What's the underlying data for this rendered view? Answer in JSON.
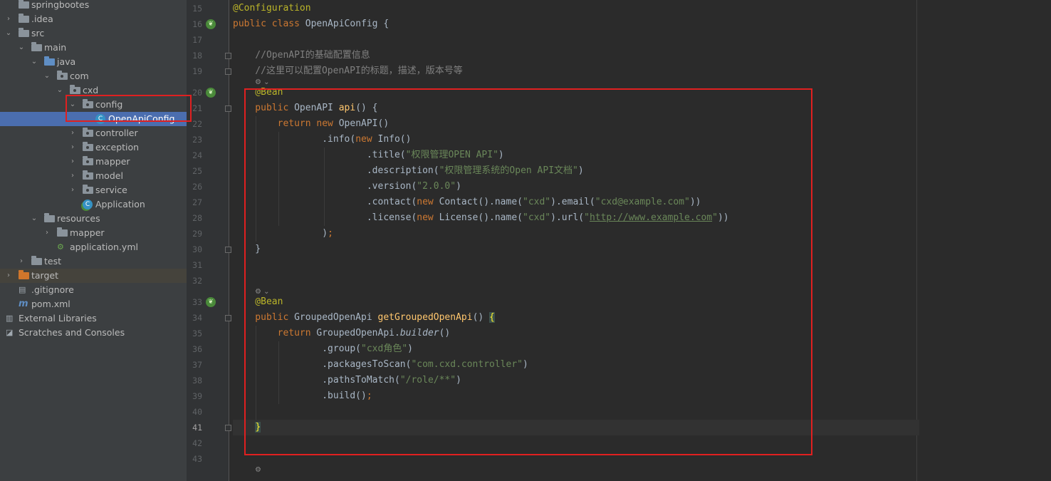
{
  "tree": {
    "items": [
      {
        "label": "springbootes",
        "depth": 0,
        "arrow": "",
        "icon": "folder"
      },
      {
        "label": ".idea",
        "depth": 0,
        "arrow": "›",
        "icon": "folder"
      },
      {
        "label": "src",
        "depth": 0,
        "arrow": "⌄",
        "icon": "folder"
      },
      {
        "label": "main",
        "depth": 1,
        "arrow": "⌄",
        "icon": "folder"
      },
      {
        "label": "java",
        "depth": 2,
        "arrow": "⌄",
        "icon": "folder-blue"
      },
      {
        "label": "com",
        "depth": 3,
        "arrow": "⌄",
        "icon": "package"
      },
      {
        "label": "cxd",
        "depth": 4,
        "arrow": "⌄",
        "icon": "package"
      },
      {
        "label": "config",
        "depth": 5,
        "arrow": "⌄",
        "icon": "package"
      },
      {
        "label": "OpenApiConfig",
        "depth": 6,
        "arrow": "",
        "icon": "class",
        "selected": true
      },
      {
        "label": "controller",
        "depth": 5,
        "arrow": "›",
        "icon": "package"
      },
      {
        "label": "exception",
        "depth": 5,
        "arrow": "›",
        "icon": "package"
      },
      {
        "label": "mapper",
        "depth": 5,
        "arrow": "›",
        "icon": "package"
      },
      {
        "label": "model",
        "depth": 5,
        "arrow": "›",
        "icon": "package"
      },
      {
        "label": "service",
        "depth": 5,
        "arrow": "›",
        "icon": "package"
      },
      {
        "label": "Application",
        "depth": 5,
        "arrow": "",
        "icon": "spring-class"
      },
      {
        "label": "resources",
        "depth": 2,
        "arrow": "⌄",
        "icon": "resources"
      },
      {
        "label": "mapper",
        "depth": 3,
        "arrow": "›",
        "icon": "folder"
      },
      {
        "label": "application.yml",
        "depth": 3,
        "arrow": "",
        "icon": "yml"
      },
      {
        "label": "test",
        "depth": 1,
        "arrow": "›",
        "icon": "folder"
      },
      {
        "label": "target",
        "depth": 0,
        "arrow": "›",
        "icon": "folder-orange"
      },
      {
        "label": ".gitignore",
        "depth": 0,
        "arrow": "",
        "icon": "file"
      },
      {
        "label": "pom.xml",
        "depth": 0,
        "arrow": "",
        "icon": "maven"
      },
      {
        "label": "External Libraries",
        "depth": -1,
        "arrow": "",
        "icon": "libraries"
      },
      {
        "label": "Scratches and Consoles",
        "depth": -1,
        "arrow": "",
        "icon": "scratches"
      }
    ]
  },
  "editor": {
    "current_line": "41",
    "lines": [
      {
        "n": "15",
        "code": [
          {
            "t": "@Configuration",
            "c": "an"
          }
        ]
      },
      {
        "n": "16",
        "code": [
          {
            "t": "public class ",
            "c": "kw"
          },
          {
            "t": "OpenApiConfig {",
            "c": ""
          }
        ]
      },
      {
        "n": "17",
        "code": []
      },
      {
        "n": "18",
        "code": [
          {
            "t": "    //OpenAPI的基础配置信息",
            "c": "cm"
          }
        ]
      },
      {
        "n": "19",
        "code": [
          {
            "t": "    //这里可以配置OpenAPI的标题，描述，版本号等",
            "c": "cm"
          }
        ]
      },
      {
        "n": "20",
        "code": [
          {
            "t": "    @Bean",
            "c": "an"
          }
        ]
      },
      {
        "n": "21",
        "code": [
          {
            "t": "    public ",
            "c": "kw"
          },
          {
            "t": "OpenAPI ",
            "c": ""
          },
          {
            "t": "api",
            "c": "fn"
          },
          {
            "t": "() {",
            "c": ""
          }
        ]
      },
      {
        "n": "22",
        "code": [
          {
            "t": "        return new ",
            "c": "kw"
          },
          {
            "t": "OpenAPI()",
            "c": ""
          }
        ]
      },
      {
        "n": "23",
        "code": [
          {
            "t": "                .info(",
            "c": ""
          },
          {
            "t": "new ",
            "c": "kw"
          },
          {
            "t": "Info()",
            "c": ""
          }
        ]
      },
      {
        "n": "24",
        "code": [
          {
            "t": "                        .title(",
            "c": ""
          },
          {
            "t": "\"权限管理OPEN API\"",
            "c": "st"
          },
          {
            "t": ")",
            "c": ""
          }
        ]
      },
      {
        "n": "25",
        "code": [
          {
            "t": "                        .description(",
            "c": ""
          },
          {
            "t": "\"权限管理系统的Open API文档\"",
            "c": "st"
          },
          {
            "t": ")",
            "c": ""
          }
        ]
      },
      {
        "n": "26",
        "code": [
          {
            "t": "                        .version(",
            "c": ""
          },
          {
            "t": "\"2.0.0\"",
            "c": "st"
          },
          {
            "t": ")",
            "c": ""
          }
        ]
      },
      {
        "n": "27",
        "code": [
          {
            "t": "                        .contact(",
            "c": ""
          },
          {
            "t": "new ",
            "c": "kw"
          },
          {
            "t": "Contact().name(",
            "c": ""
          },
          {
            "t": "\"cxd\"",
            "c": "st"
          },
          {
            "t": ").email(",
            "c": ""
          },
          {
            "t": "\"cxd@example.com\"",
            "c": "st"
          },
          {
            "t": "))",
            "c": ""
          }
        ]
      },
      {
        "n": "28",
        "code": [
          {
            "t": "                        .license(",
            "c": ""
          },
          {
            "t": "new ",
            "c": "kw"
          },
          {
            "t": "License().name(",
            "c": ""
          },
          {
            "t": "\"cxd\"",
            "c": "st"
          },
          {
            "t": ").url(",
            "c": ""
          },
          {
            "t": "\"",
            "c": "st"
          },
          {
            "t": "http://www.example.com",
            "c": "lnk"
          },
          {
            "t": "\"",
            "c": "st"
          },
          {
            "t": "))",
            "c": ""
          }
        ]
      },
      {
        "n": "29",
        "code": [
          {
            "t": "                )",
            "c": ""
          },
          {
            "t": ";",
            "c": "kw"
          }
        ]
      },
      {
        "n": "30",
        "code": [
          {
            "t": "    }",
            "c": ""
          }
        ]
      },
      {
        "n": "31",
        "code": []
      },
      {
        "n": "32",
        "code": []
      },
      {
        "n": "33",
        "code": [
          {
            "t": "    @Bean",
            "c": "an"
          }
        ]
      },
      {
        "n": "34",
        "code": [
          {
            "t": "    public ",
            "c": "kw"
          },
          {
            "t": "GroupedOpenApi ",
            "c": ""
          },
          {
            "t": "getGroupedOpenApi",
            "c": "fn"
          },
          {
            "t": "() ",
            "c": ""
          },
          {
            "t": "{",
            "c": "hl"
          }
        ]
      },
      {
        "n": "35",
        "code": [
          {
            "t": "        return ",
            "c": "kw"
          },
          {
            "t": "GroupedOpenApi.",
            "c": ""
          },
          {
            "t": "builder",
            "c": "it"
          },
          {
            "t": "()",
            "c": ""
          }
        ]
      },
      {
        "n": "36",
        "code": [
          {
            "t": "                .group(",
            "c": ""
          },
          {
            "t": "\"cxd角色\"",
            "c": "st"
          },
          {
            "t": ")",
            "c": ""
          }
        ]
      },
      {
        "n": "37",
        "code": [
          {
            "t": "                .packagesToScan(",
            "c": ""
          },
          {
            "t": "\"com.cxd.controller\"",
            "c": "st"
          },
          {
            "t": ")",
            "c": ""
          }
        ]
      },
      {
        "n": "38",
        "code": [
          {
            "t": "                .pathsToMatch(",
            "c": ""
          },
          {
            "t": "\"/role/**\"",
            "c": "st"
          },
          {
            "t": ")",
            "c": ""
          }
        ]
      },
      {
        "n": "39",
        "code": [
          {
            "t": "                .build()",
            "c": ""
          },
          {
            "t": ";",
            "c": "kw"
          }
        ]
      },
      {
        "n": "40",
        "code": []
      },
      {
        "n": "41",
        "code": [
          {
            "t": "    ",
            "c": ""
          },
          {
            "t": "}",
            "c": "hl"
          }
        ]
      },
      {
        "n": "42",
        "code": []
      },
      {
        "n": "43",
        "code": []
      }
    ]
  },
  "hints": [
    {
      "label": "⚙ ⌄",
      "after_line": "19"
    },
    {
      "label": "⚙ ⌄",
      "after_line": "32"
    },
    {
      "label": "⚙",
      "after_line": "43"
    }
  ],
  "colors": {
    "annotation_box": "#e02020",
    "selection": "#4b6eaf",
    "keyword": "#cc7832",
    "annotation": "#bbb529",
    "string": "#6a8759",
    "method": "#ffc66d"
  }
}
